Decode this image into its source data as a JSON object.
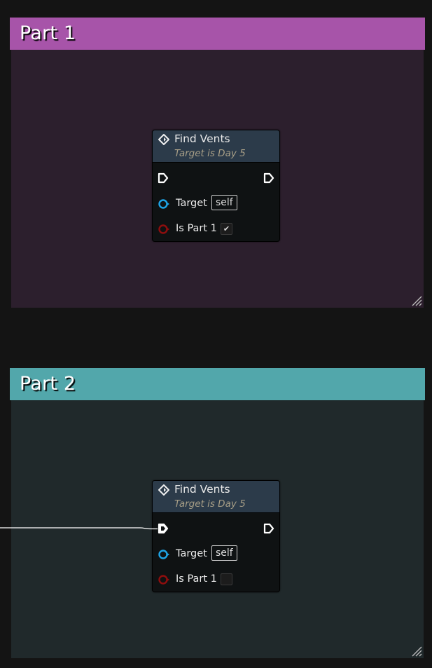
{
  "comments": [
    {
      "title": "Part 1",
      "header_color": "#a754a9",
      "body_color": "#2c1f2d",
      "node": {
        "title": "Find Vents",
        "subtitle": "Target is Day 5",
        "target_label": "Target",
        "target_value": "self",
        "bool_label": "Is Part 1",
        "bool_checked": true,
        "check_glyph": "✔",
        "exec_in_connected": false
      }
    },
    {
      "title": "Part 2",
      "header_color": "#52a7ab",
      "body_color": "#20292b",
      "node": {
        "title": "Find Vents",
        "subtitle": "Target is Day 5",
        "target_label": "Target",
        "target_value": "self",
        "bool_label": "Is Part 1",
        "bool_checked": false,
        "check_glyph": "",
        "exec_in_connected": true
      }
    }
  ],
  "colors": {
    "canvas": "#141414",
    "node_header": "#2c3b4a",
    "object_pin": "#1ea4e6",
    "bool_pin": "#8e0e0e",
    "exec_pin": "#ffffff",
    "wire": "#ffffff"
  },
  "icons": {
    "node_icon": "function-diamond-icon",
    "exec_pin_icon": "exec-arrow-icon",
    "resize_icon": "resize-grip-icon"
  }
}
